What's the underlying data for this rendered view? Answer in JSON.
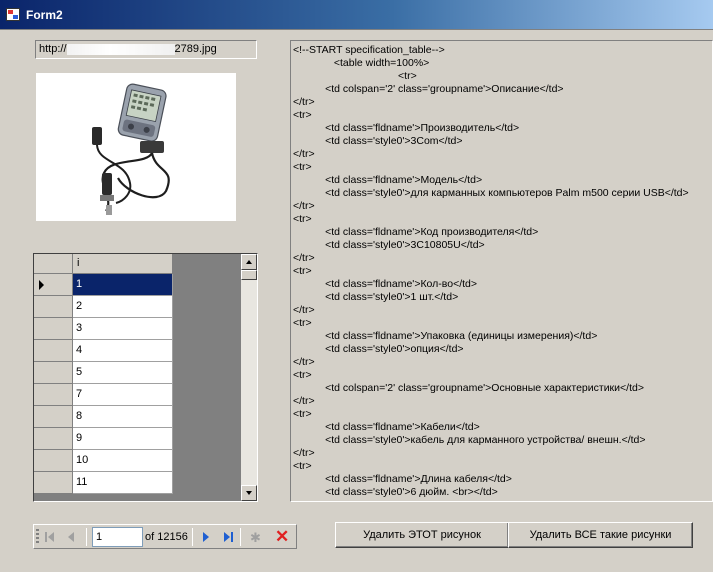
{
  "window": {
    "title": "Form2"
  },
  "url_field": {
    "prefix": "http://",
    "suffix": "2789.jpg"
  },
  "grid": {
    "column_header": "i",
    "rows": [
      "1",
      "2",
      "3",
      "4",
      "5",
      "7",
      "8",
      "9",
      "10",
      "11"
    ],
    "selected_index": 0
  },
  "code_lines": [
    "<!--START specification_table-->",
    "              <table width=100%>",
    "                                    <tr>",
    "           <td colspan='2' class='groupname'>Описание</td>",
    "</tr>",
    "<tr>",
    "           <td class='fldname'>Производитель</td>",
    "           <td class='style0'>3Com</td>",
    "</tr>",
    "<tr>",
    "           <td class='fldname'>Модель</td>",
    "           <td class='style0'>для карманных компьютеров Palm m500 серии USB</td>",
    "</tr>",
    "<tr>",
    "           <td class='fldname'>Код производителя</td>",
    "           <td class='style0'>3C10805U</td>",
    "</tr>",
    "<tr>",
    "           <td class='fldname'>Кол-во</td>",
    "           <td class='style0'>1 шт.</td>",
    "</tr>",
    "<tr>",
    "           <td class='fldname'>Упаковка (единицы измерения)</td>",
    "           <td class='style0'>опция</td>",
    "</tr>",
    "<tr>",
    "           <td colspan='2' class='groupname'>Основные характеристики</td>",
    "</tr>",
    "<tr>",
    "           <td class='fldname'>Кабели</td>",
    "           <td class='style0'>кабель для карманного устройства/ внешн.</td>",
    "</tr>",
    "<tr>",
    "           <td class='fldname'>Длина кабеля</td>",
    "           <td class='style0'>6 дюйм. <br></td>"
  ],
  "navigator": {
    "position": "1",
    "count_text": "of 12156"
  },
  "buttons": {
    "delete_this": "Удалить ЭТОТ рисунок",
    "delete_all": "Удалить ВСЕ такие рисунки"
  },
  "colors": {
    "titlebar": "#0a246a",
    "selection": "#0a246a",
    "window_bg": "#d4d0c8",
    "delete_red": "#e02020",
    "nav_blue": "#1f5fd1"
  },
  "icons": [
    "app-icon",
    "grip-icon",
    "first-icon",
    "prev-icon",
    "next-icon",
    "last-icon",
    "add-icon",
    "delete-icon",
    "device-photo"
  ]
}
